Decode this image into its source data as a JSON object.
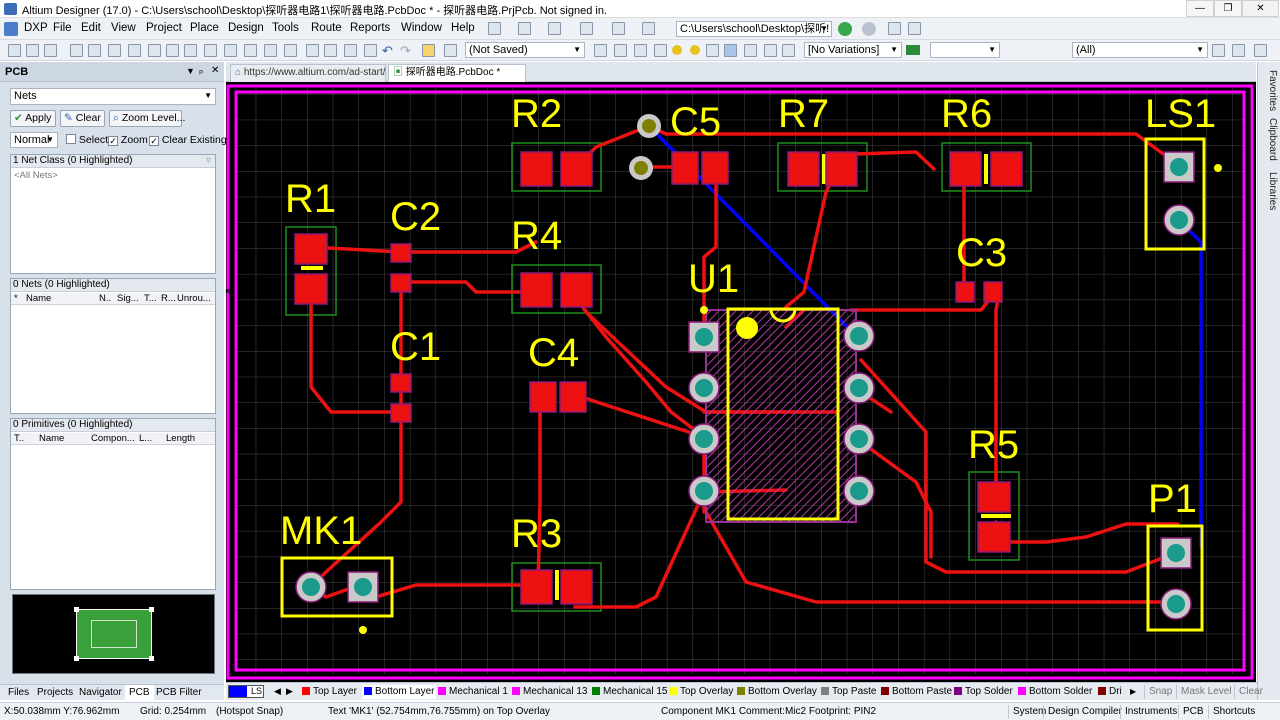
{
  "window": {
    "title": "Altium Designer (17.0) - C:\\Users\\school\\Desktop\\探听器电路1\\探听器电路.PcbDoc * - 探听器电路.PrjPcb. Not signed in."
  },
  "menu": [
    "DXP",
    "File",
    "Edit",
    "View",
    "Project",
    "Place",
    "Design",
    "Tools",
    "Route",
    "Reports",
    "Window",
    "Help"
  ],
  "toolbar": {
    "path": "C:\\Users\\school\\Desktop\\探听!",
    "saved_state": "(Not Saved)",
    "variations": "[No Variations]",
    "filter_all": "(All)"
  },
  "panel": {
    "title": "PCB",
    "mode": "Nets",
    "apply": "Apply",
    "clear": "Clear",
    "zoom_level": "Zoom Level...",
    "normal": "Normal",
    "select_label": "Select",
    "zoom_label": "Zoom",
    "clear_existing_label": "Clear Existing",
    "net_class_header": "1 Net Class (0 Highlighted)",
    "net_class_item": "<All Nets>",
    "nets_header": "0 Nets (0 Highlighted)",
    "nets_cols": [
      "*",
      "Name",
      "N..",
      "Sig...",
      "T...",
      "R...",
      "Unrou..."
    ],
    "prims_header": "0 Primitives (0 Highlighted)",
    "prims_cols": [
      "T..",
      "Name",
      "Compon...",
      "L...",
      "Length"
    ]
  },
  "panel_tabs": [
    "Files",
    "Projects",
    "Navigator",
    "PCB",
    "PCB Filter"
  ],
  "doc_tabs": [
    "https://www.altium.com/ad-start/",
    "探听器电路.PcbDoc *"
  ],
  "right_tabs": [
    "Favorites",
    "Clipboard",
    "Libraries"
  ],
  "pcb": {
    "designators": [
      "R2",
      "C5",
      "R7",
      "R6",
      "LS1",
      "R1",
      "C2",
      "R4",
      "U1",
      "C3",
      "C1",
      "C4",
      "R5",
      "P1",
      "MK1",
      "R3"
    ],
    "colors": {
      "background": "#000000",
      "top_layer": "#ff0000",
      "bottom_layer": "#0000ff",
      "overlay": "#ffff00",
      "mechanical": "#ff00ff",
      "pad": "#c0c0c0",
      "via": "#808000"
    }
  },
  "layers": [
    {
      "name": "LS",
      "color": "#0000ff"
    },
    {
      "name": "Top Layer",
      "color": "#ff0000"
    },
    {
      "name": "Bottom Layer",
      "color": "#0000ff"
    },
    {
      "name": "Mechanical 1",
      "color": "#ff00ff"
    },
    {
      "name": "Mechanical 13",
      "color": "#ff00ff"
    },
    {
      "name": "Mechanical 15",
      "color": "#008000"
    },
    {
      "name": "Top Overlay",
      "color": "#ffff00"
    },
    {
      "name": "Bottom Overlay",
      "color": "#808000"
    },
    {
      "name": "Top Paste",
      "color": "#808080"
    },
    {
      "name": "Bottom Paste",
      "color": "#800000"
    },
    {
      "name": "Top Solder",
      "color": "#800080"
    },
    {
      "name": "Bottom Solder",
      "color": "#ff00ff"
    },
    {
      "name": "Dri",
      "color": "#800000"
    }
  ],
  "layer_buttons": [
    "Snap",
    "Mask Level",
    "Clear"
  ],
  "status": {
    "coords": "X:50.038mm Y:76.962mm",
    "grid": "Grid: 0.254mm",
    "snap": "(Hotspot Snap)",
    "text_info": "Text 'MK1' (52.754mm,76.755mm) on Top Overlay",
    "component_info": "Component MK1 Comment:Mic2 Footprint: PIN2",
    "buttons": [
      "System",
      "Design Compiler",
      "Instruments",
      "PCB",
      "Shortcuts"
    ]
  }
}
